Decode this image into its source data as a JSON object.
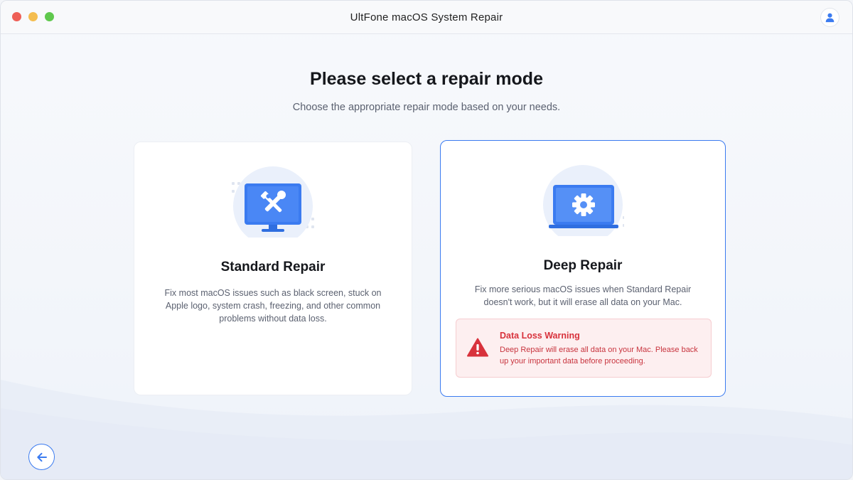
{
  "window": {
    "title": "UltFone macOS System Repair"
  },
  "main": {
    "heading": "Please select a repair mode",
    "subheading": "Choose the appropriate repair mode based on your needs."
  },
  "cards": [
    {
      "title": "Standard Repair",
      "description": "Fix most macOS issues such as black screen, stuck on Apple logo, system crash, freezing, and other common problems without data loss.",
      "icon": "tools-monitor-icon",
      "selected": false
    },
    {
      "title": "Deep Repair",
      "description": "Fix more serious macOS issues when Standard Repair doesn't work, but it will erase all data on your Mac.",
      "icon": "gear-laptop-icon",
      "selected": true,
      "warning": {
        "title": "Data Loss Warning",
        "text": "Deep Repair will erase all data on your Mac. Please back up your important data before proceeding.",
        "icon": "warning-triangle-icon"
      }
    }
  ],
  "icons": {
    "account": "user-icon",
    "back": "arrow-left-icon"
  },
  "colors": {
    "accent": "#3b7bf0",
    "warning_text": "#d8323c",
    "warning_bg": "#fdeff0",
    "traffic_close": "#ee5f57",
    "traffic_minimize": "#f4bd4f",
    "traffic_maximize": "#5fc84d"
  }
}
